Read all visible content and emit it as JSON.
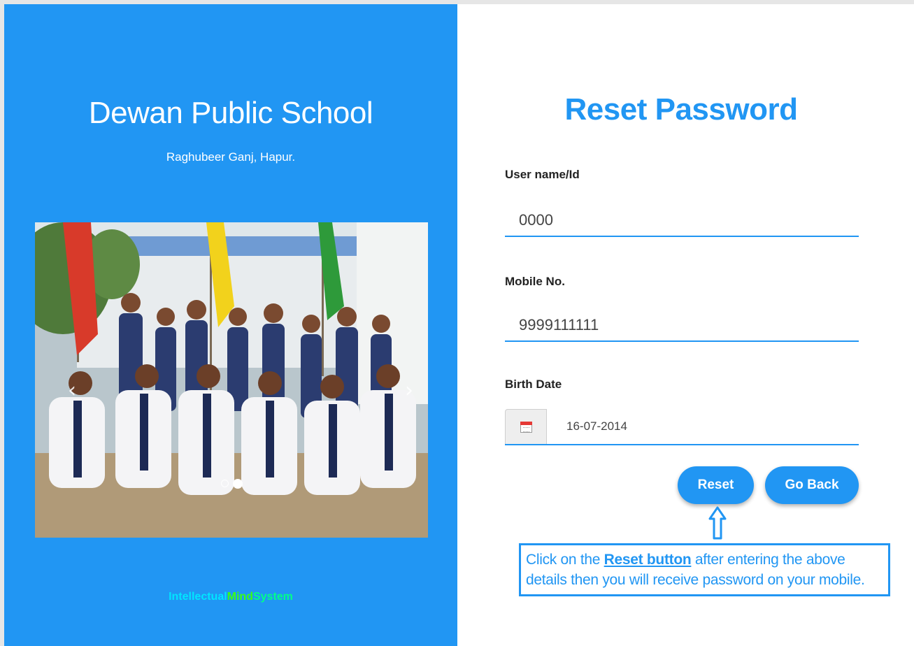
{
  "school": {
    "name": "Dewan Public School",
    "address": "Raghubeer Ganj, Hapur."
  },
  "carousel": {
    "prev_icon": "chevron-left-icon",
    "next_icon": "chevron-right-icon",
    "prev_glyph": "‹",
    "next_glyph": "›",
    "slide_count": 2,
    "active_slide": 2
  },
  "brand": {
    "part1": "Intellectual",
    "part2": "Mind",
    "part3": "System"
  },
  "form": {
    "title": "Reset Password",
    "username_label": "User name/Id",
    "username_value": "0000",
    "mobile_label": "Mobile No.",
    "mobile_value": "9999111111",
    "birthdate_label": "Birth Date",
    "birthdate_value": "16-07-2014",
    "calendar_icon": "calendar-icon",
    "reset_label": "Reset",
    "back_label": "Go Back"
  },
  "hint": {
    "text_before": "Click on the ",
    "highlight": "Reset button",
    "text_after": " after entering the above details then you will receive password on your mobile."
  },
  "colors": {
    "primary": "#2196f3",
    "brand_cyan": "#00e5ff",
    "brand_green": "#39ff14"
  }
}
